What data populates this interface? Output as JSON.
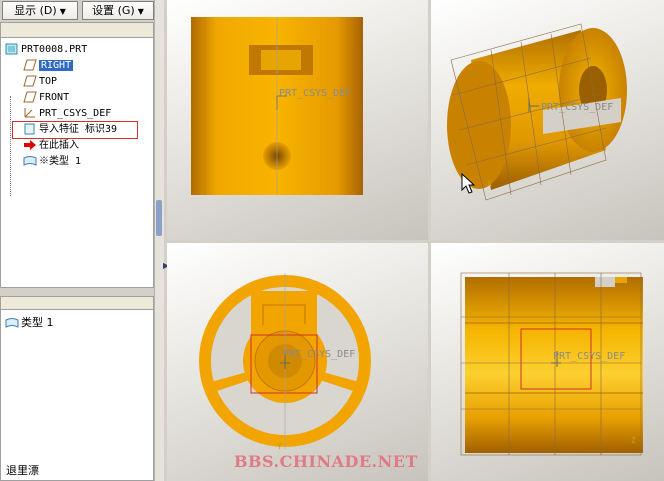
{
  "toolbar": {
    "show_label": "显示 (D)",
    "settings_label": "设置 (G)"
  },
  "model_tree": {
    "items": [
      {
        "label": "PRT0008.PRT",
        "icon": "part-icon"
      },
      {
        "label": "RIGHT",
        "icon": "datum-plane-icon",
        "selected": true
      },
      {
        "label": "TOP",
        "icon": "datum-plane-icon"
      },
      {
        "label": "FRONT",
        "icon": "datum-plane-icon"
      },
      {
        "label": "PRT_CSYS_DEF",
        "icon": "csys-icon"
      },
      {
        "label": "导入特征 标识39",
        "icon": "import-feature-icon",
        "highlighted": true
      },
      {
        "label": "在此插入",
        "icon": "insert-here-arrow-icon"
      },
      {
        "label": "※类型 1",
        "icon": "layer-icon"
      }
    ]
  },
  "bottom_panel": {
    "item_label": "类型 1",
    "item_icon": "layer-icon"
  },
  "status_text": "退里漂",
  "viewports": {
    "csys_label": "PRT_CSYS_DEF",
    "csys_label_tr": "PRT_CSYS_DEF",
    "csys_label_bl": "PRT_CSYS_DEF",
    "csys_label_br": "PRT_CSYS_DEF"
  },
  "watermark": "BBS.CHINADE.NET",
  "colors": {
    "part_orange": "#e8a000",
    "selection_blue": "#316ac5",
    "highlight_red": "#d03030"
  }
}
